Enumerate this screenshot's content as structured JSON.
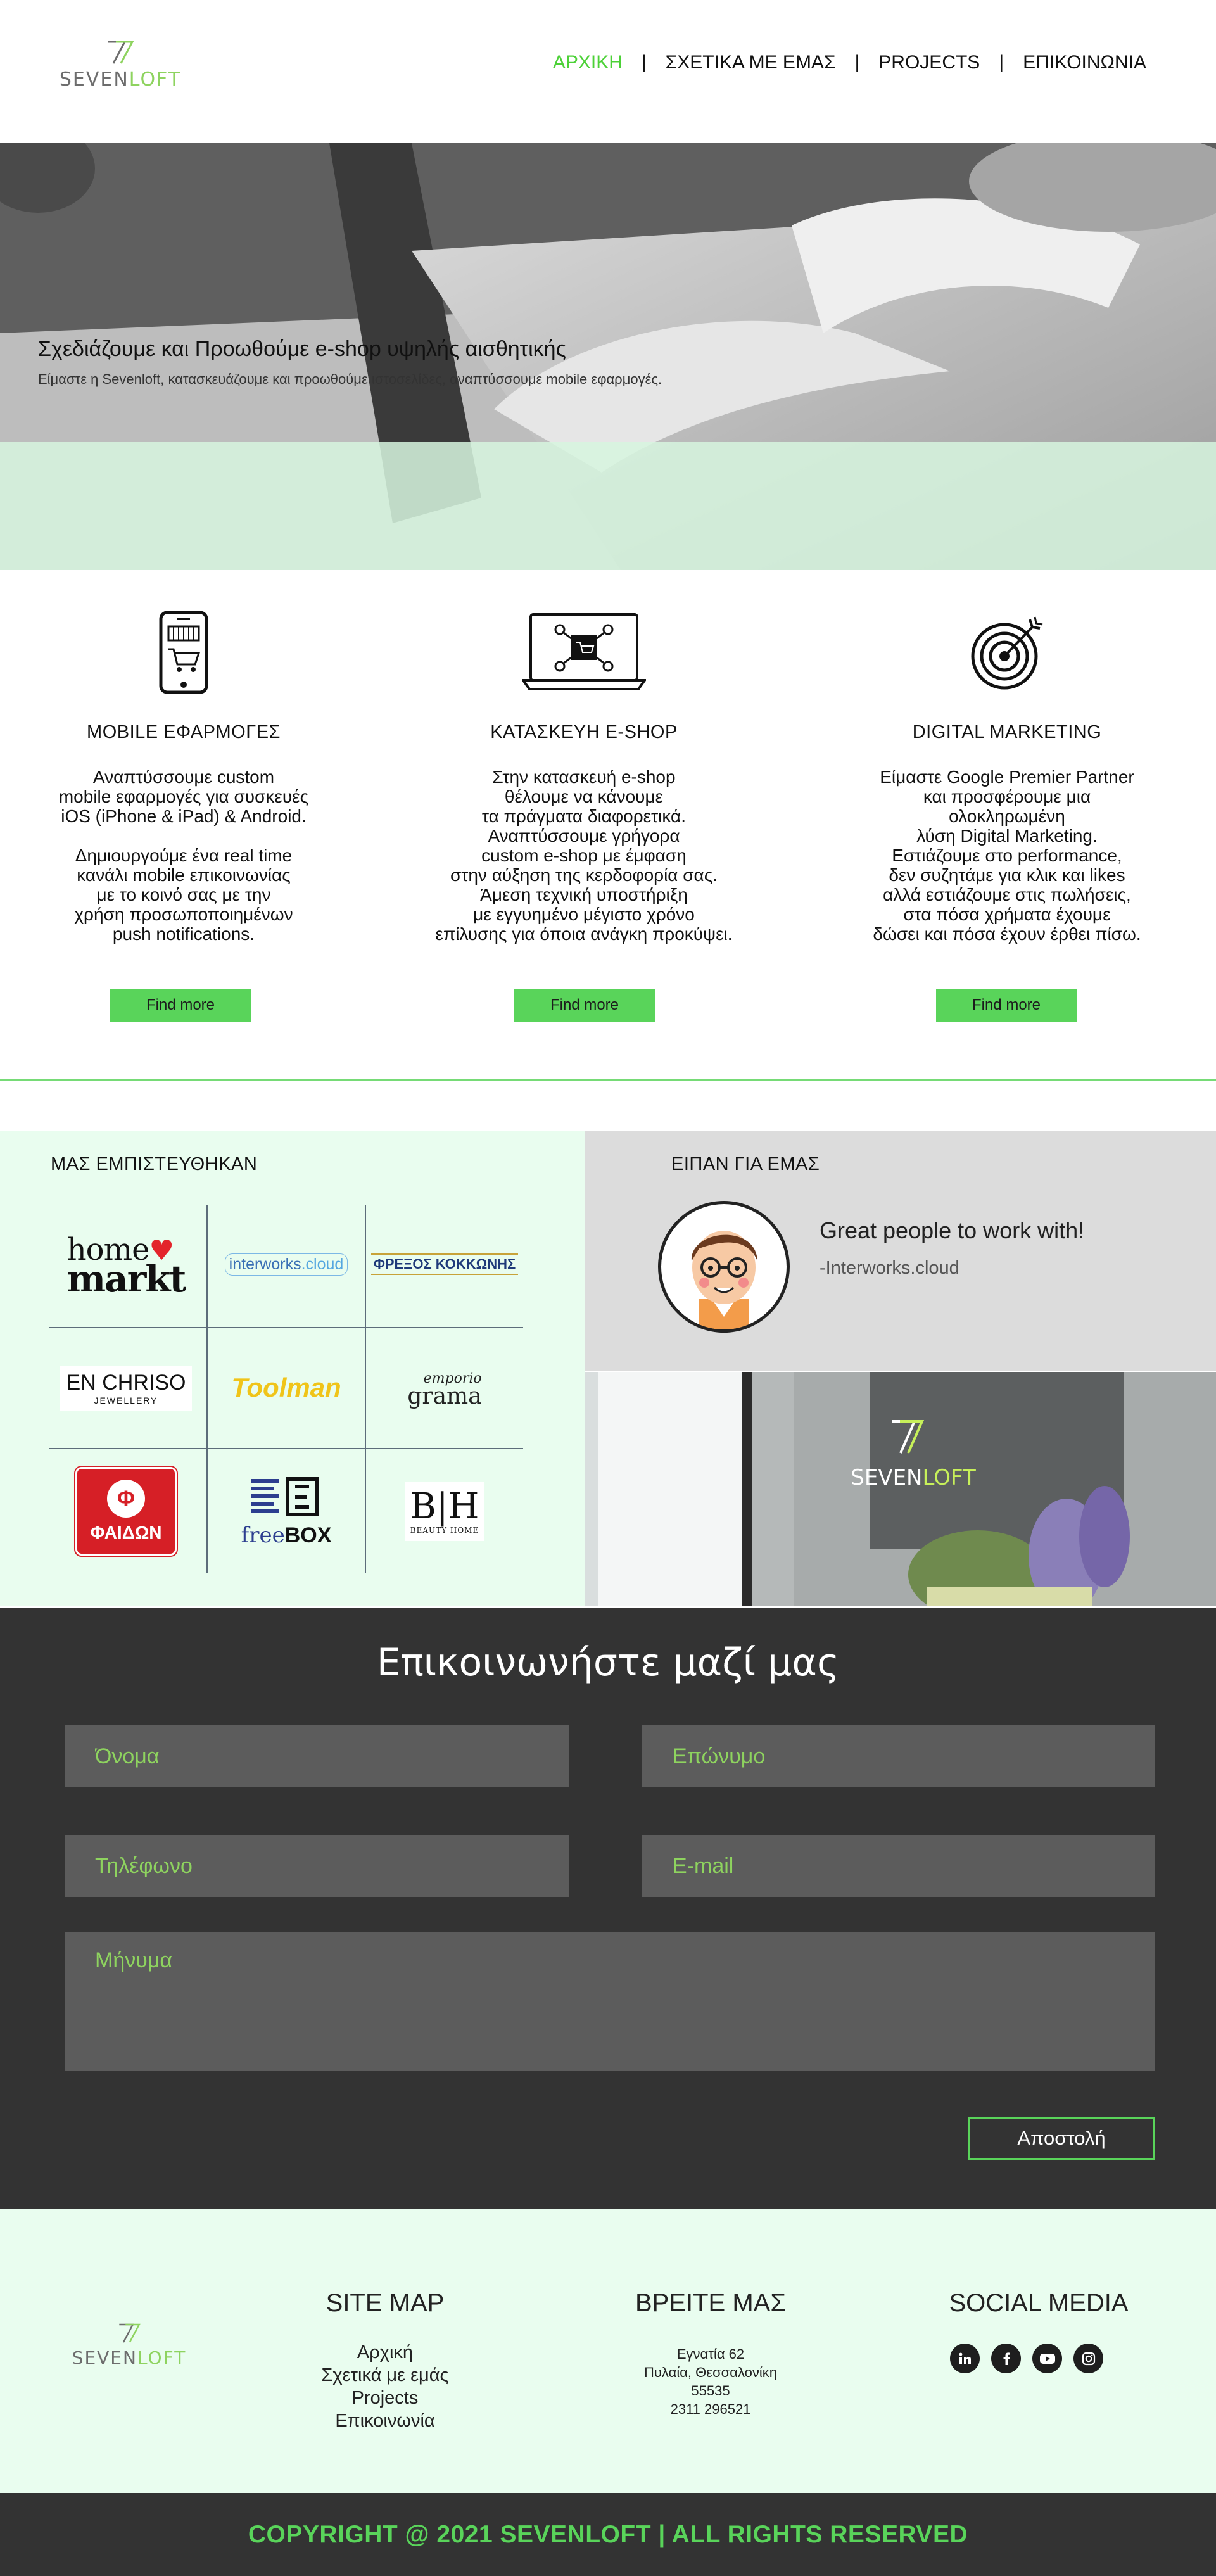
{
  "brand": {
    "name_part1": "SEVEN",
    "name_part2": "LOFT",
    "accent": "#8ed35f",
    "green": "#59d45a"
  },
  "nav": {
    "items": [
      {
        "label": "ΑΡΧΙΚΗ",
        "active": true
      },
      {
        "label": "ΣΧΕΤΙΚΑ ΜΕ ΕΜΑΣ",
        "active": false
      },
      {
        "label": "PROJECTS",
        "active": false
      },
      {
        "label": "ΕΠΙΚΟΙΝΩΝΙΑ",
        "active": false
      }
    ],
    "separator": "|"
  },
  "hero": {
    "title": "Σχεδιάζουμε και Προωθούμε e-shop υψηλής αισθητικής",
    "subtitle": "Είμαστε η Sevenloft, κατασκευάζουμε και προωθούμε ιστοσελίδες, αναπτύσσουμε mobile εφαρμογές."
  },
  "services": [
    {
      "icon": "smartphone-cart-icon",
      "title": "MOBILE ΕΦΑΡΜΟΓΕΣ",
      "text": "Αναπτύσσουμε custom\nmobile εφαρμογές για συσκευές\niOS (iPhone & iPad) & Android.\n\nΔημιουργούμε ένα real time\nκανάλι mobile επικοινωνίας\nμε το κοινό σας με την\nχρήση προσωποποιημένων\npush notifications.",
      "button": "Find more"
    },
    {
      "icon": "laptop-eshop-icon",
      "title": "ΚΑΤΑΣΚΕΥΗ E-SHOP",
      "text": "Στην κατασκευή e-shop\nθέλουμε να κάνουμε\nτα πράγματα διαφορετικά.\nΑναπτύσσουμε γρήγορα\ncustom e-shop με έμφαση\nστην αύξηση της κερδοφορία σας.\nΆμεση τεχνική υποστήριξη\nμε εγγυημένο μέγιστο χρόνο\nεπίλυσης για όποια ανάγκη προκύψει.",
      "button": "Find more"
    },
    {
      "icon": "target-icon",
      "title": "DIGITAL MARKETING",
      "text": "Είμαστε Google Premier Partner\nκαι προσφέρουμε μια\nολοκληρωμένη\nλύση Digital Marketing.\nΕστιάζουμε στο performance,\nδεν συζητάμε για κλικ και likes\nαλλά εστιάζουμε στις πωλήσεις,\nστα πόσα χρήματα έχουμε\nδώσει και πόσα έχουν έρθει πίσω.",
      "button": "Find more"
    }
  ],
  "trusted": {
    "label": "ΜΑΣ ΕΜΠΙΣΤΕΥΘΗΚΑΝ",
    "logos": [
      {
        "name": "home-markt-logo",
        "text1": "home",
        "text2": "markt"
      },
      {
        "name": "interworks-logo",
        "text1": "interworks",
        "text2": ".cloud"
      },
      {
        "name": "fraxos-kokkonis-logo",
        "text1": "ΦΡΕΞΟΣ ΚΟΚΚΩΝΗΣ"
      },
      {
        "name": "en-chriso-logo",
        "text1": "EN CHRISO",
        "text2": "JEWELLERY"
      },
      {
        "name": "toolman-logo",
        "text1": "Toolman"
      },
      {
        "name": "emporio-grama-logo",
        "text1": "emporio",
        "text2": "grama"
      },
      {
        "name": "faidon-logo",
        "text1": "ΦΑΙΔΩΝ"
      },
      {
        "name": "freebox-logo",
        "text1": "free",
        "text2": "BOX"
      },
      {
        "name": "bh-beauty-home-logo",
        "text1": "B|H",
        "text2": "BEAUTY HOME"
      }
    ]
  },
  "testimonial": {
    "label": "ΕΙΠΑΝ ΓΙΑ ΕΜΑΣ",
    "quote": "Great people to work with!",
    "source": "-Interworks.cloud"
  },
  "contact": {
    "title": "Επικοινωνήστε μαζί μας",
    "first_name_placeholder": "Όνομα",
    "last_name_placeholder": "Επώνυμο",
    "phone_placeholder": "Τηλέφωνο",
    "email_placeholder": "E-mail",
    "message_placeholder": "Μήνυμα",
    "send_label": "Αποστολή"
  },
  "footer": {
    "sitemap_title": "SITE MAP",
    "sitemap_items": [
      "Αρχική",
      "Σχετικά με εμάς",
      "Projects",
      "Επικοινωνία"
    ],
    "find_title": "ΒΡΕΙΤΕ ΜΑΣ",
    "address_lines": [
      "Εγνατία 62",
      "Πυλαία, Θεσσαλονίκη",
      "55535",
      "2311 296521"
    ],
    "social_title": "SOCIAL MEDIA",
    "social_icons": [
      "linkedin-icon",
      "facebook-icon",
      "youtube-icon",
      "instagram-icon"
    ],
    "copyright": "COPYRIGHT @ 2021 SEVENLOFT | ALL RIGHTS RESERVED"
  }
}
